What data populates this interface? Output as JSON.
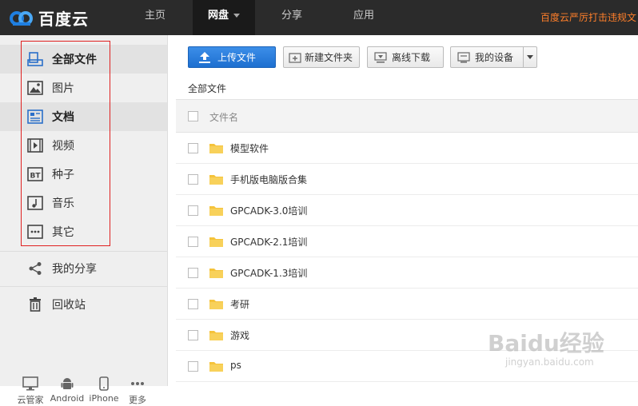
{
  "brand": {
    "name": "百度云",
    "accent": "#1d6fd0",
    "logo_blue": "#1f7fe0"
  },
  "nav": {
    "items": [
      {
        "label": "主页"
      },
      {
        "label": "网盘"
      },
      {
        "label": "分享"
      },
      {
        "label": "应用"
      }
    ],
    "notice": "百度云严厉打击违规文"
  },
  "sidebar": {
    "categories": [
      {
        "label": "全部文件",
        "icon": "all-files-icon"
      },
      {
        "label": "图片",
        "icon": "image-icon"
      },
      {
        "label": "文档",
        "icon": "document-icon"
      },
      {
        "label": "视频",
        "icon": "video-icon"
      },
      {
        "label": "种子",
        "icon": "bt-icon"
      },
      {
        "label": "音乐",
        "icon": "music-icon"
      },
      {
        "label": "其它",
        "icon": "more-dots-icon"
      }
    ],
    "share": {
      "label": "我的分享",
      "icon": "share-icon"
    },
    "trash": {
      "label": "回收站",
      "icon": "trash-icon"
    },
    "devices": [
      {
        "label": "云管家",
        "icon": "monitor-icon"
      },
      {
        "label": "Android",
        "icon": "android-icon"
      },
      {
        "label": "iPhone",
        "icon": "phone-icon"
      },
      {
        "label": "更多",
        "icon": "ellipsis-icon"
      }
    ]
  },
  "toolbar": {
    "upload": "上传文件",
    "new_folder": "新建文件夹",
    "offline_download": "离线下载",
    "my_devices": "我的设备"
  },
  "breadcrumb": "全部文件",
  "file_list": {
    "header": "文件名",
    "rows": [
      {
        "name": "模型软件"
      },
      {
        "name": "手机版电脑版合集"
      },
      {
        "name": "GPCADK-3.0培训"
      },
      {
        "name": "GPCADK-2.1培训"
      },
      {
        "name": "GPCADK-1.3培训"
      },
      {
        "name": "考研"
      },
      {
        "name": "游戏"
      },
      {
        "name": "ps"
      }
    ]
  },
  "watermark": {
    "text": "Baidu经验",
    "sub": "jingyan.baidu.com"
  }
}
